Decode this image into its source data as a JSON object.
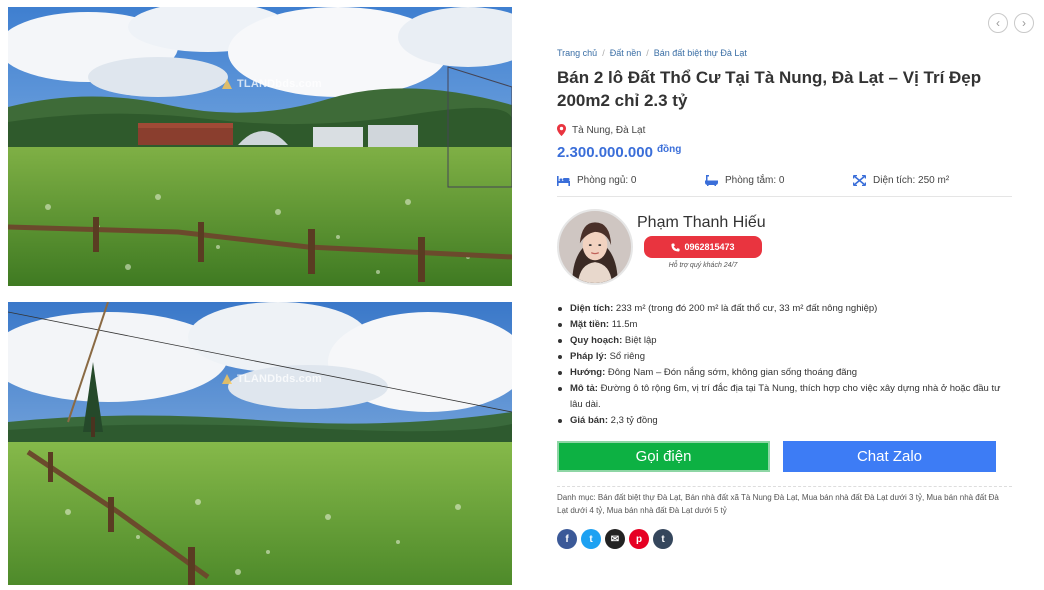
{
  "photos": {
    "watermark": "TLANDbds.com"
  },
  "navigation": {
    "prev_icon": "chevron-left-icon",
    "next_icon": "chevron-right-icon"
  },
  "breadcrumb": {
    "items": [
      "Trang chủ",
      "Đất nền",
      "Bán đất biệt thự Đà Lạt"
    ],
    "separator": "/"
  },
  "listing": {
    "title": "Bán 2 lô Đất Thổ Cư Tại Tà Nung, Đà Lạt – Vị Trí Đẹp 200m2 chỉ 2.3 tỷ",
    "location": "Tà Nung, Đà Lạt",
    "price": "2.300.000.000",
    "price_unit": "đồng",
    "features": {
      "bedrooms": "Phòng ngủ: 0",
      "bathrooms": "Phòng tắm: 0",
      "area": "Diện tích: 250 m²"
    }
  },
  "agent": {
    "name": "Phạm Thanh Hiếu",
    "phone": "0962815473",
    "support": "Hỗ trợ quý khách 24/7"
  },
  "details": [
    {
      "label": "Diện tích:",
      "value": "233 m² (trong đó 200 m² là đất thổ cư, 33 m² đất nông nghiệp)"
    },
    {
      "label": "Mặt tiền:",
      "value": "11.5m"
    },
    {
      "label": "Quy hoạch:",
      "value": "Biệt lập"
    },
    {
      "label": "Pháp lý:",
      "value": "Sổ riêng"
    },
    {
      "label": "Hướng:",
      "value": "Đông Nam – Đón nắng sớm, không gian sống thoáng đãng"
    },
    {
      "label": "Mô tả:",
      "value": "Đường ô tô rộng 6m, vị trí đắc địa tại Tà Nung, thích hợp cho việc xây dựng nhà ở hoặc đầu tư lâu dài."
    },
    {
      "label": "Giá bán:",
      "value": "2,3 tỷ đồng"
    }
  ],
  "actions": {
    "call_label": "Gọi điện",
    "zalo_label": "Chat Zalo"
  },
  "category": {
    "label": "Danh mục:",
    "links": "Bán đất biệt thự Đà Lạt, Bán nhà đất xã Tà Nung Đà Lạt, Mua bán nhà đất Đà Lạt dưới 3 tỷ, Mua bán nhà đất Đà Lạt dưới 4 tỷ, Mua bán nhà đất Đà Lạt dưới 5 tỷ"
  },
  "share": [
    {
      "icon": "facebook-icon",
      "glyph": "f",
      "color": "#3b5998"
    },
    {
      "icon": "twitter-icon",
      "glyph": "t",
      "color": "#1da1f2"
    },
    {
      "icon": "email-icon",
      "glyph": "✉",
      "color": "#222222"
    },
    {
      "icon": "pinterest-icon",
      "glyph": "p",
      "color": "#e60023"
    },
    {
      "icon": "tumblr-icon",
      "glyph": "t",
      "color": "#35465c"
    }
  ],
  "colors": {
    "price": "#3a6ed9",
    "phone_button": "#e9343f",
    "call_button": "#0db143",
    "zalo_button": "#3d7cf5"
  }
}
